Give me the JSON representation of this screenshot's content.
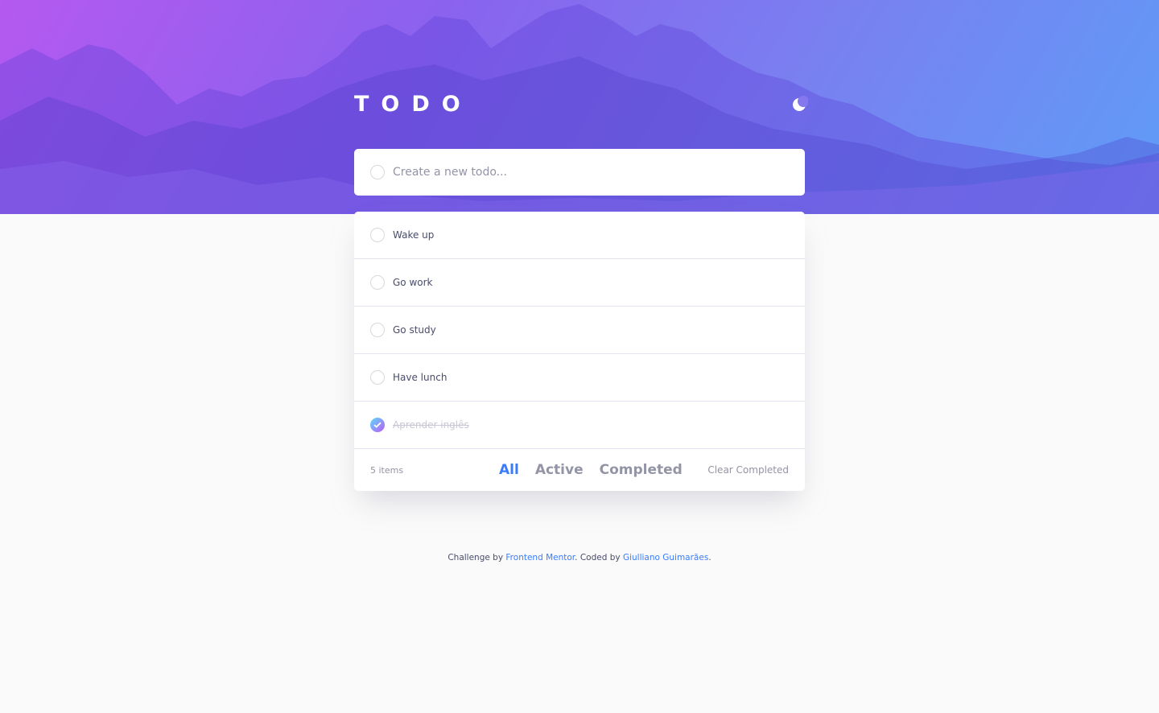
{
  "app": {
    "title": "TODO"
  },
  "new_todo": {
    "placeholder": "Create a new todo..."
  },
  "todos": [
    {
      "text": "Wake up",
      "completed": false
    },
    {
      "text": "Go work",
      "completed": false
    },
    {
      "text": "Go study",
      "completed": false
    },
    {
      "text": "Have lunch",
      "completed": false
    },
    {
      "text": "Aprender inglês",
      "completed": true
    }
  ],
  "footer": {
    "count": "5 items",
    "filters": [
      "All",
      "Active",
      "Completed"
    ],
    "active_filter": "All",
    "clear": "Clear Completed"
  },
  "attribution": {
    "prefix": "Challenge by",
    "link1": "Frontend Mentor",
    "middle": ". Coded by",
    "link2": "Giulliano Guimarães",
    "suffix": "."
  },
  "icons": {
    "theme_toggle": "moon-icon",
    "check": "check-icon"
  },
  "colors": {
    "accent": "#3a7cfd",
    "gradient_start": "#57ddff",
    "gradient_end": "#c058f3"
  }
}
